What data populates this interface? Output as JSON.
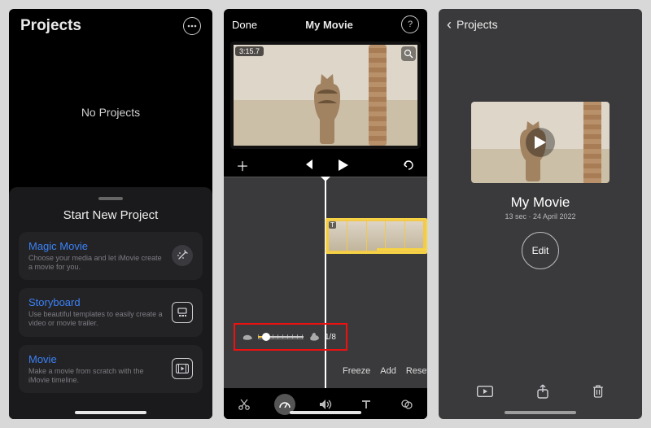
{
  "panel1": {
    "title": "Projects",
    "empty_label": "No Projects",
    "sheet_title": "Start New Project",
    "cards": [
      {
        "name": "Magic Movie",
        "desc": "Choose your media and let iMovie create a movie for you.",
        "icon": "magic-wand-icon"
      },
      {
        "name": "Storyboard",
        "desc": "Use beautiful templates to easily create a video or movie trailer.",
        "icon": "storyboard-icon"
      },
      {
        "name": "Movie",
        "desc": "Make a movie from scratch with the iMovie timeline.",
        "icon": "filmstrip-icon"
      }
    ]
  },
  "panel2": {
    "done_label": "Done",
    "title": "My Movie",
    "timecode": "3:15.7",
    "speed": {
      "value_label": "1/8"
    },
    "actions": {
      "freeze": "Freeze",
      "add": "Add",
      "reset": "Reset"
    },
    "highlight_color": "#e11"
  },
  "panel3": {
    "back_label": "Projects",
    "title": "My Movie",
    "subtitle": "13 sec · 24 April 2022",
    "edit_label": "Edit"
  }
}
